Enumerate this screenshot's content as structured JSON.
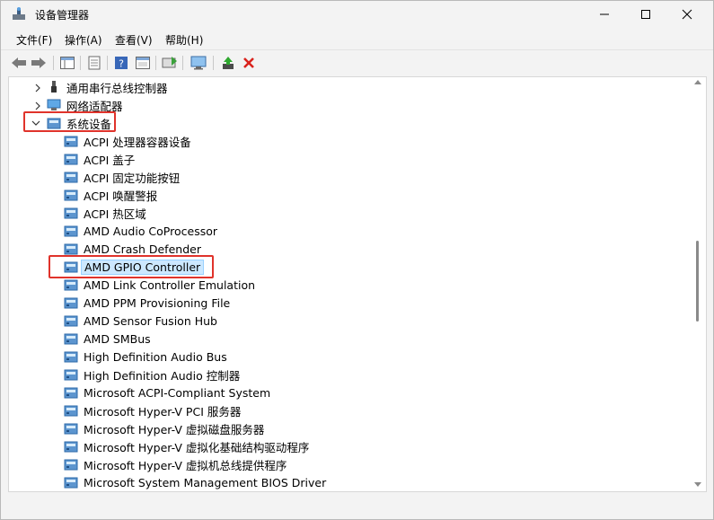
{
  "window": {
    "title": "设备管理器"
  },
  "menu": [
    "文件(F)",
    "操作(A)",
    "查看(V)",
    "帮助(H)"
  ],
  "toolbar": [
    "back-icon",
    "forward-icon",
    "properties-window-icon",
    "details-icon",
    "help-icon",
    "console-icon",
    "monitor-scan-icon",
    "update-driver-icon",
    "remove-icon"
  ],
  "tree": {
    "categories": [
      {
        "label": "通用串行总线控制器",
        "expanded": false
      },
      {
        "label": "网络适配器",
        "expanded": false
      },
      {
        "label": "系统设备",
        "expanded": true
      }
    ],
    "devices": [
      "ACPI 处理器容器设备",
      "ACPI 盖子",
      "ACPI 固定功能按钮",
      "ACPI 唤醒警报",
      "ACPI 热区域",
      "AMD Audio CoProcessor",
      "AMD Crash Defender",
      "AMD GPIO Controller",
      "AMD Link Controller Emulation",
      "AMD PPM Provisioning File",
      "AMD Sensor Fusion Hub",
      "AMD SMBus",
      "High Definition Audio Bus",
      "High Definition Audio 控制器",
      "Microsoft ACPI-Compliant System",
      "Microsoft Hyper-V PCI 服务器",
      "Microsoft Hyper-V 虚拟磁盘服务器",
      "Microsoft Hyper-V 虚拟化基础结构驱动程序",
      "Microsoft Hyper-V 虚拟机总线提供程序",
      "Microsoft System Management BIOS Driver"
    ],
    "selected_device": "AMD GPIO Controller"
  },
  "colors": {
    "highlight": "#e0332b",
    "selection_bg": "#cce8ff"
  }
}
